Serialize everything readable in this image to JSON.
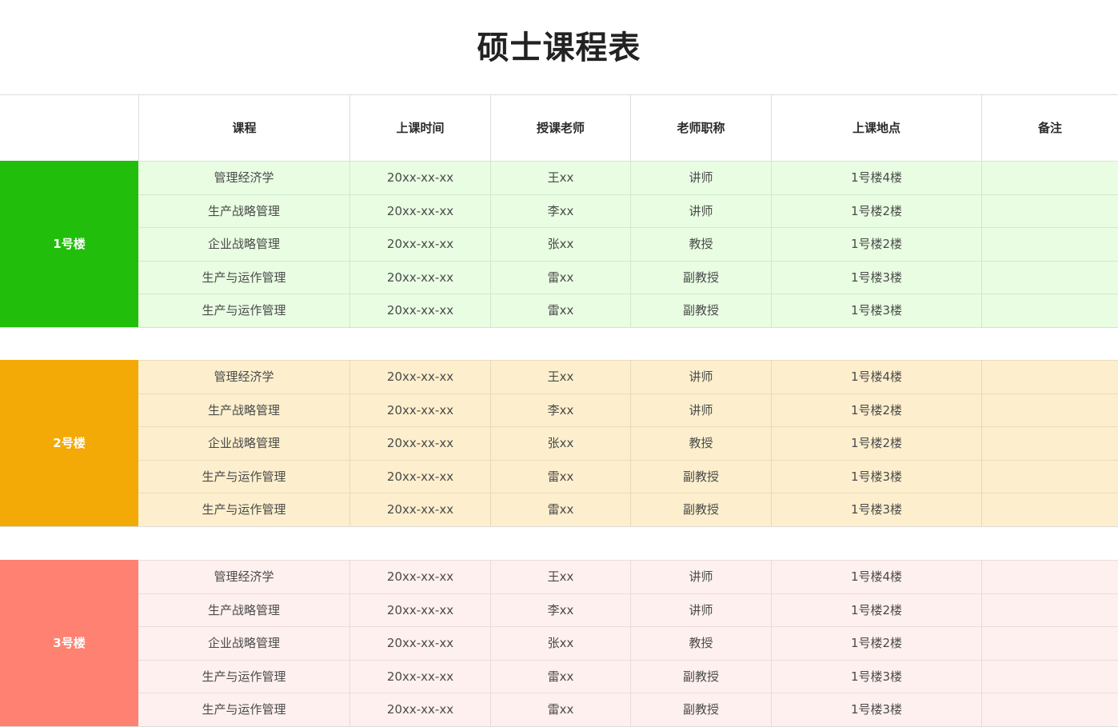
{
  "title": "硕士课程表",
  "columns": [
    "课程",
    "上课时间",
    "授课老师",
    "老师职称",
    "上课地点",
    "备注"
  ],
  "colors": {
    "group1_label": "#21bf0b",
    "group1_row": "#e8fde2",
    "group2_label": "#f3a906",
    "group2_row": "#fdefcd",
    "group3_label": "#fe8172",
    "group3_row": "#fef0ee"
  },
  "groups": [
    {
      "label": "1号楼",
      "rows": [
        [
          "管理经济学",
          "20xx-xx-xx",
          "王xx",
          "讲师",
          "1号楼4楼",
          ""
        ],
        [
          "生产战略管理",
          "20xx-xx-xx",
          "李xx",
          "讲师",
          "1号楼2楼",
          ""
        ],
        [
          "企业战略管理",
          "20xx-xx-xx",
          "张xx",
          "教授",
          "1号楼2楼",
          ""
        ],
        [
          "生产与运作管理",
          "20xx-xx-xx",
          "雷xx",
          "副教授",
          "1号楼3楼",
          ""
        ],
        [
          "生产与运作管理",
          "20xx-xx-xx",
          "雷xx",
          "副教授",
          "1号楼3楼",
          ""
        ]
      ]
    },
    {
      "label": "2号楼",
      "rows": [
        [
          "管理经济学",
          "20xx-xx-xx",
          "王xx",
          "讲师",
          "1号楼4楼",
          ""
        ],
        [
          "生产战略管理",
          "20xx-xx-xx",
          "李xx",
          "讲师",
          "1号楼2楼",
          ""
        ],
        [
          "企业战略管理",
          "20xx-xx-xx",
          "张xx",
          "教授",
          "1号楼2楼",
          ""
        ],
        [
          "生产与运作管理",
          "20xx-xx-xx",
          "雷xx",
          "副教授",
          "1号楼3楼",
          ""
        ],
        [
          "生产与运作管理",
          "20xx-xx-xx",
          "雷xx",
          "副教授",
          "1号楼3楼",
          ""
        ]
      ]
    },
    {
      "label": "3号楼",
      "rows": [
        [
          "管理经济学",
          "20xx-xx-xx",
          "王xx",
          "讲师",
          "1号楼4楼",
          ""
        ],
        [
          "生产战略管理",
          "20xx-xx-xx",
          "李xx",
          "讲师",
          "1号楼2楼",
          ""
        ],
        [
          "企业战略管理",
          "20xx-xx-xx",
          "张xx",
          "教授",
          "1号楼2楼",
          ""
        ],
        [
          "生产与运作管理",
          "20xx-xx-xx",
          "雷xx",
          "副教授",
          "1号楼3楼",
          ""
        ],
        [
          "生产与运作管理",
          "20xx-xx-xx",
          "雷xx",
          "副教授",
          "1号楼3楼",
          ""
        ]
      ]
    }
  ]
}
